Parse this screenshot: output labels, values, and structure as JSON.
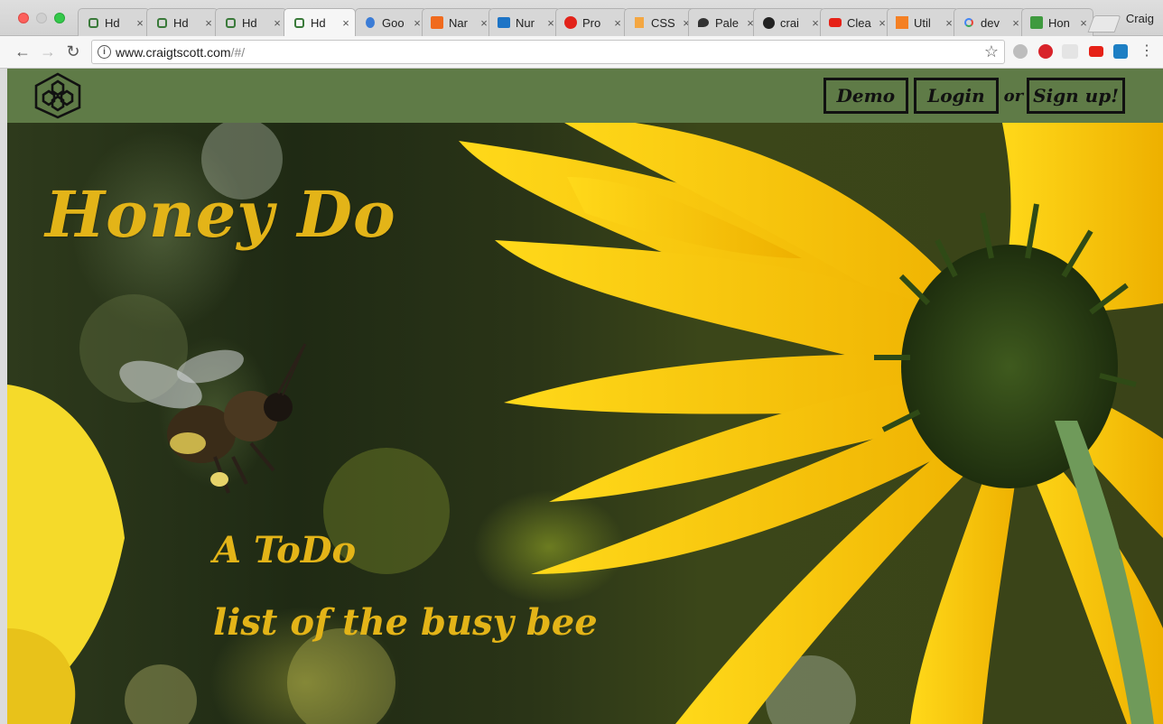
{
  "browser": {
    "tabs": [
      {
        "label": "Hd",
        "icon": "honeycomb-icon",
        "active": false
      },
      {
        "label": "Hd",
        "icon": "honeycomb-icon",
        "active": false
      },
      {
        "label": "Hd",
        "icon": "honeycomb-icon",
        "active": false
      },
      {
        "label": "Hd",
        "icon": "honeycomb-icon",
        "active": true
      },
      {
        "label": "Goo",
        "icon": "blue-drop-icon",
        "active": false
      },
      {
        "label": "Nar",
        "icon": "orange-chart-icon",
        "active": false
      },
      {
        "label": "Nur",
        "icon": "blue-camera-icon",
        "active": false
      },
      {
        "label": "Pro",
        "icon": "red-a-icon",
        "active": false
      },
      {
        "label": "CSS",
        "icon": "stack-icon",
        "active": false
      },
      {
        "label": "Pale",
        "icon": "palette-icon",
        "active": false
      },
      {
        "label": "crai",
        "icon": "github-icon",
        "active": false
      },
      {
        "label": "Clea",
        "icon": "youtube-icon",
        "active": false
      },
      {
        "label": "Util",
        "icon": "stackoverflow-icon",
        "active": false
      },
      {
        "label": "dev",
        "icon": "google-icon",
        "active": false
      },
      {
        "label": "Hon",
        "icon": "trello-icon",
        "active": false
      }
    ],
    "tab_close": "×",
    "profile_name": "Craig",
    "url_host": "www.craigtscott.com",
    "url_path": "/#/"
  },
  "site": {
    "nav": {
      "demo": "Demo",
      "login": "Login",
      "or": "or",
      "signup": "Sign up!"
    },
    "title": "Honey Do",
    "subtitle_line1": "A ToDo",
    "subtitle_line2": "list of the busy bee",
    "colors": {
      "nav_bg": "#5f7b47",
      "title": "#e3b418",
      "petal": "#f6c50b"
    }
  }
}
